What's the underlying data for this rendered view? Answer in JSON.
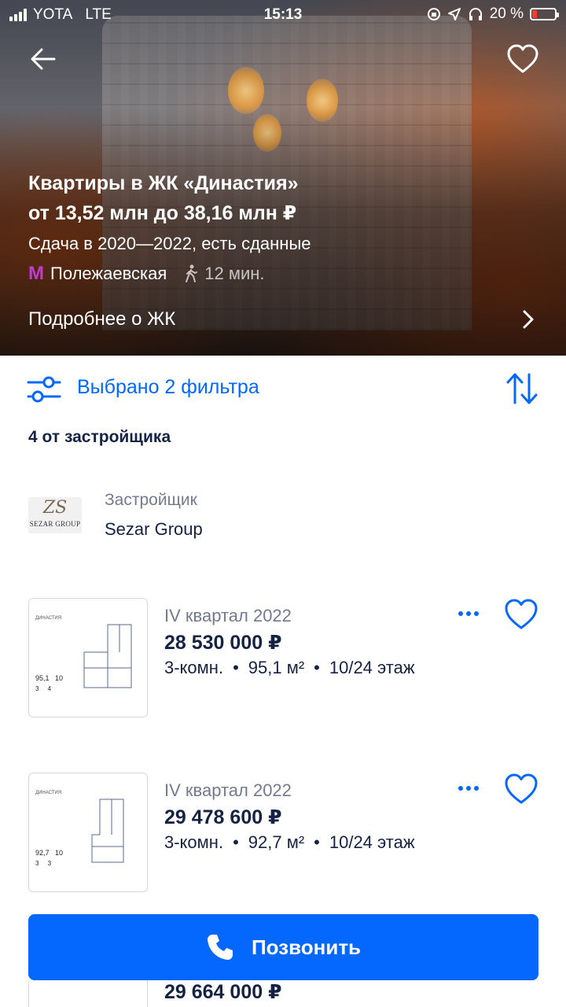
{
  "status": {
    "carrier": "YOTA",
    "network": "LTE",
    "time": "15:13",
    "battery": "20 %"
  },
  "hero": {
    "title": "Квартиры в ЖК «Династия»",
    "price_range": "от 13,52 млн до 38,16 млн ₽",
    "delivery": "Сдача в 2020—2022, есть сданные",
    "metro_icon": "М",
    "metro": "Полежаевская",
    "walk_time": "12 мин.",
    "more_link": "Подробнее о ЖК"
  },
  "filters": {
    "label": "Выбрано 2 фильтра"
  },
  "listing_count": "4 от застройщика",
  "developer": {
    "caption": "Застройщик",
    "name": "Sezar Group",
    "logo_mono": "ZS",
    "logo_text": "SEZAR GROUP"
  },
  "listings": [
    {
      "quarter": "IV квартал 2022",
      "price": "28 530 000 ₽",
      "rooms": "3-комн.",
      "area": "95,1 м²",
      "floor": "10/24 этаж",
      "plan": {
        "caption": "ДИНАСТИЯ",
        "area": "95,1",
        "floor": "10",
        "rooms": "3",
        "section": "4"
      }
    },
    {
      "quarter": "IV квартал 2022",
      "price": "29 478 600 ₽",
      "rooms": "3-комн.",
      "area": "92,7 м²",
      "floor": "10/24 этаж",
      "plan": {
        "caption": "ДИНАСТИЯ",
        "area": "92,7",
        "floor": "10",
        "rooms": "3",
        "section": "3"
      }
    },
    {
      "price": "29 664 000 ₽"
    }
  ],
  "sep": "•",
  "call_button": "Позвонить",
  "colors": {
    "accent": "#0468ff",
    "dark_text": "#152242",
    "muted_text": "#737a8e",
    "metro": "#c13ad1"
  }
}
